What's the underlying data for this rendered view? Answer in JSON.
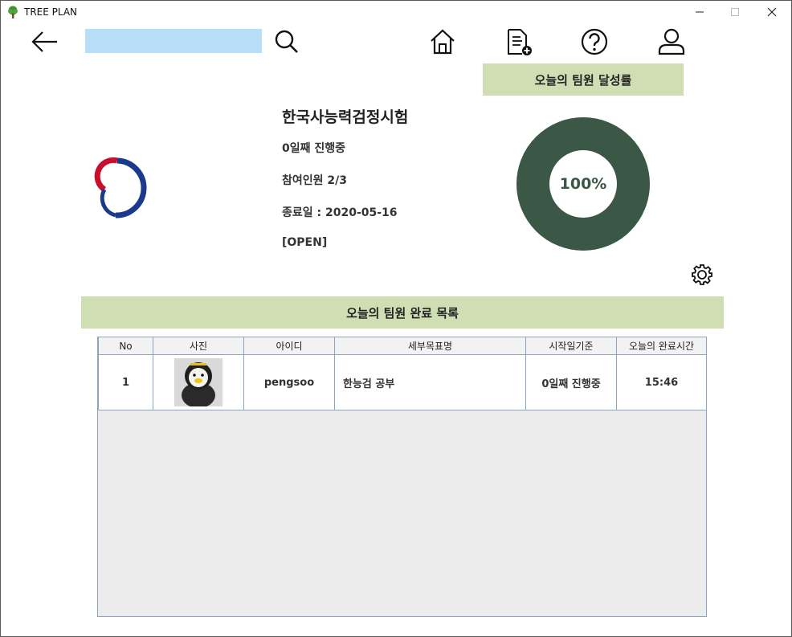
{
  "window": {
    "title": "TREE PLAN"
  },
  "search": {
    "value": "",
    "placeholder": ""
  },
  "achievement": {
    "header": "오늘의 팀원 달성률",
    "percent_label": "100%",
    "percent_value": 100,
    "color": "#3b5746"
  },
  "group": {
    "title": "한국사능력검정시험",
    "progress": "0일째 진행중",
    "members": "참여인원 2/3",
    "end_date": "종료일 : 2020-05-16",
    "status": "[OPEN]"
  },
  "list": {
    "header": "오늘의 팀원 완료 목록",
    "columns": [
      "No",
      "사진",
      "아이디",
      "세부목표명",
      "시작일기준",
      "오늘의 완료시간"
    ],
    "rows": [
      {
        "no": "1",
        "id": "pengsoo",
        "goal": "한능검 공부",
        "since": "0일째 진행중",
        "time": "15:46"
      }
    ]
  },
  "colors": {
    "accent_bar": "#d0deb4",
    "search_bg": "#b9def7",
    "donut": "#3b5746"
  },
  "icons": [
    "tree-icon",
    "back-arrow-icon",
    "search-icon",
    "home-icon",
    "document-add-icon",
    "help-icon",
    "user-icon",
    "gear-icon"
  ]
}
